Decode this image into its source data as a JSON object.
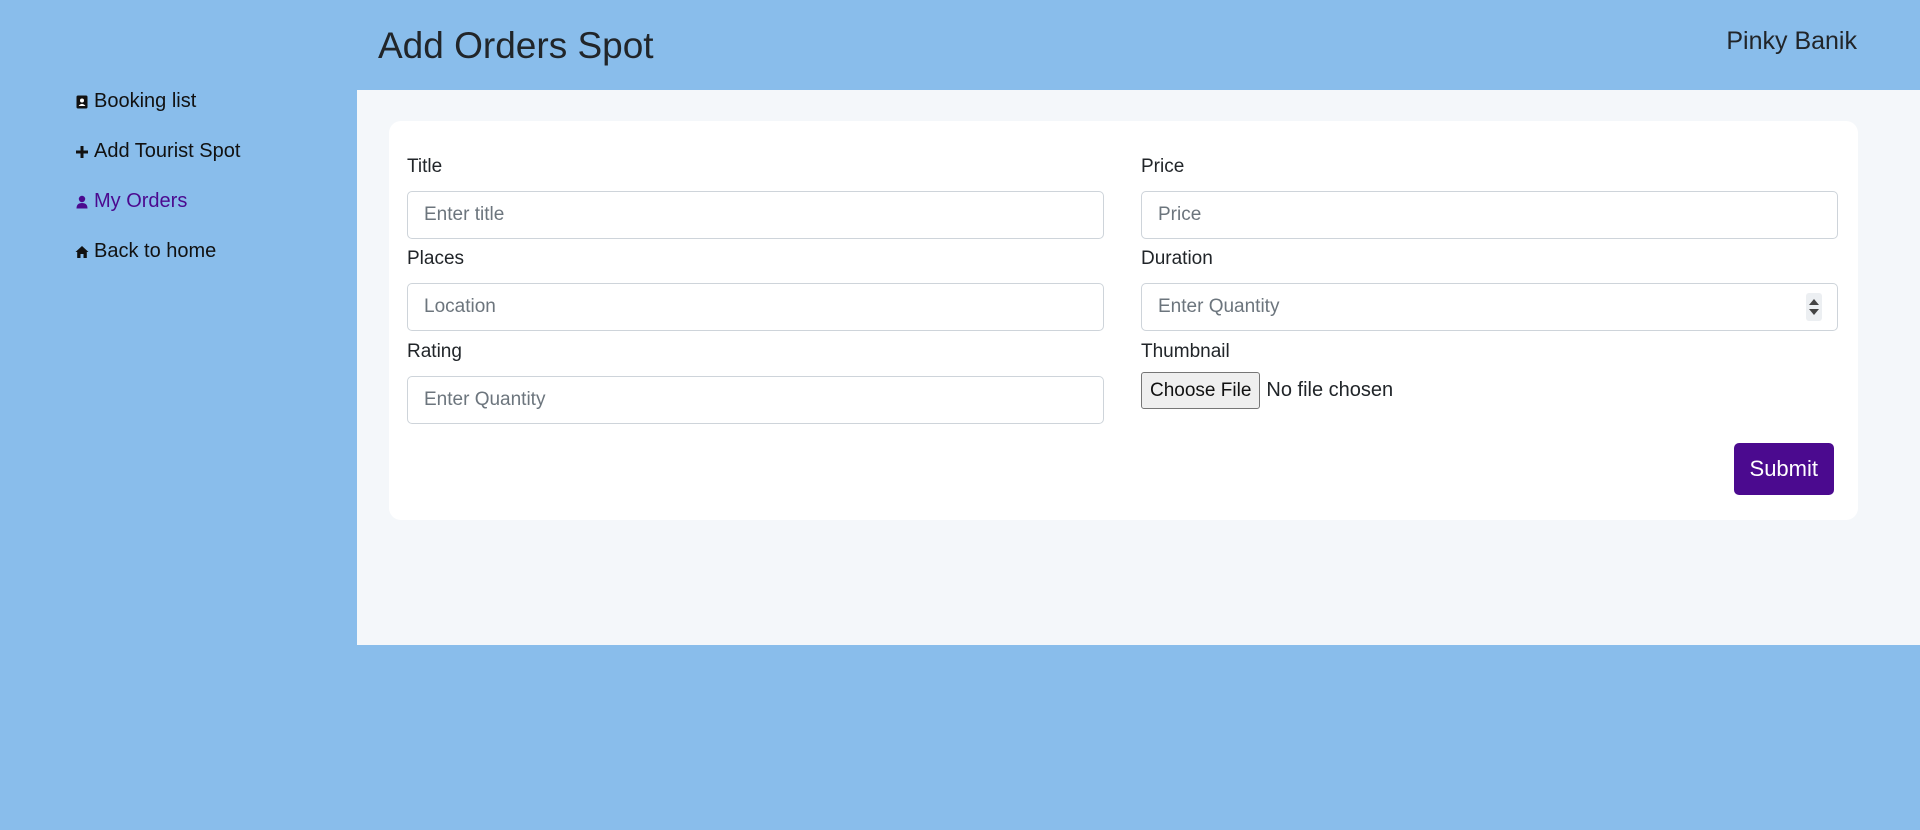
{
  "sidebar": {
    "items": [
      {
        "label": "Booking list",
        "icon": "address-book-icon"
      },
      {
        "label": "Add Tourist Spot",
        "icon": "plus-icon"
      },
      {
        "label": "My Orders",
        "icon": "user-icon",
        "active": true
      },
      {
        "label": "Back to home",
        "icon": "home-icon"
      }
    ]
  },
  "header": {
    "title": "Add Orders Spot",
    "user_name": "Pinky Banik"
  },
  "form": {
    "title_label": "Title",
    "title_placeholder": "Enter title",
    "price_label": "Price",
    "price_placeholder": "Price",
    "places_label": "Places",
    "places_placeholder": "Location",
    "duration_label": "Duration",
    "duration_placeholder": "Enter Quantity",
    "rating_label": "Rating",
    "rating_placeholder": "Enter Quantity",
    "thumbnail_label": "Thumbnail",
    "choose_file_label": "Choose File",
    "file_status": "No file chosen",
    "submit_label": "Submit"
  },
  "colors": {
    "background": "#89bdeb",
    "content_background": "#f4f7fa",
    "accent": "#4b0a8f"
  }
}
